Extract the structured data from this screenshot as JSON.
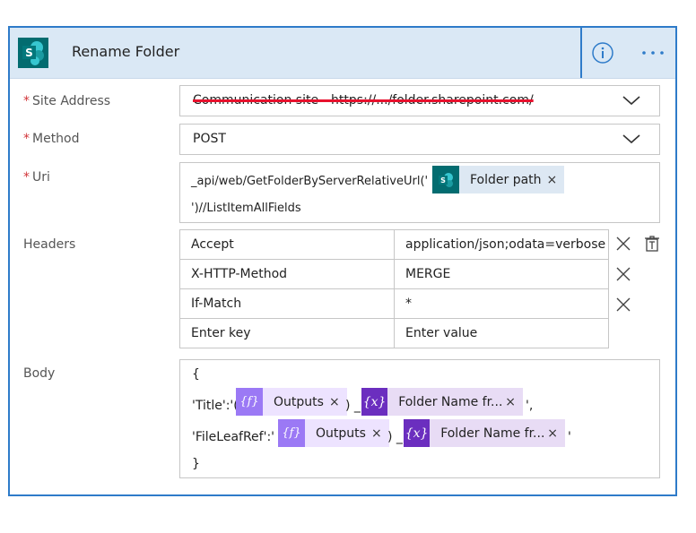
{
  "header": {
    "title": "Rename Folder",
    "icons": {
      "app": "sharepoint-logo-icon",
      "info": "info-icon",
      "more": "more-options-icon"
    }
  },
  "fields": {
    "site_address": {
      "label": "Site Address",
      "value": "Communication site - https://.../folder.sharepoint.com/"
    },
    "method": {
      "label": "Method",
      "value": "POST"
    },
    "uri": {
      "label": "Uri",
      "line1": "_api/web/GetFolderByServerRelativeUrl('",
      "token": "Folder path",
      "line2": "')//ListItemAllFields"
    },
    "headers": {
      "label": "Headers",
      "rows": [
        {
          "key": "Accept",
          "value": "application/json;odata=verbose"
        },
        {
          "key": "X-HTTP-Method",
          "value": "MERGE"
        },
        {
          "key": "If-Match",
          "value": "*"
        }
      ],
      "key_placeholder": "Enter key",
      "value_placeholder": "Enter value"
    },
    "body": {
      "label": "Body",
      "open": "{",
      "line1_prefix": "'Title':'(",
      "line1_sep": ") _",
      "line1_suffix": "',",
      "line2_prefix": "'FileLeafRef':' (",
      "line2_sep": ") _",
      "line2_suffix": "'",
      "close": "}",
      "token_outputs": "Outputs",
      "token_folder_name": "Folder Name fr..."
    }
  },
  "token_x": "×",
  "colors": {
    "accent": "#2e7bc9",
    "header_bg": "#dae8f5",
    "required": "#d13438",
    "sharepoint": "#036c70",
    "outputs": "#9b79f5",
    "variable": "#6b2ebf"
  }
}
